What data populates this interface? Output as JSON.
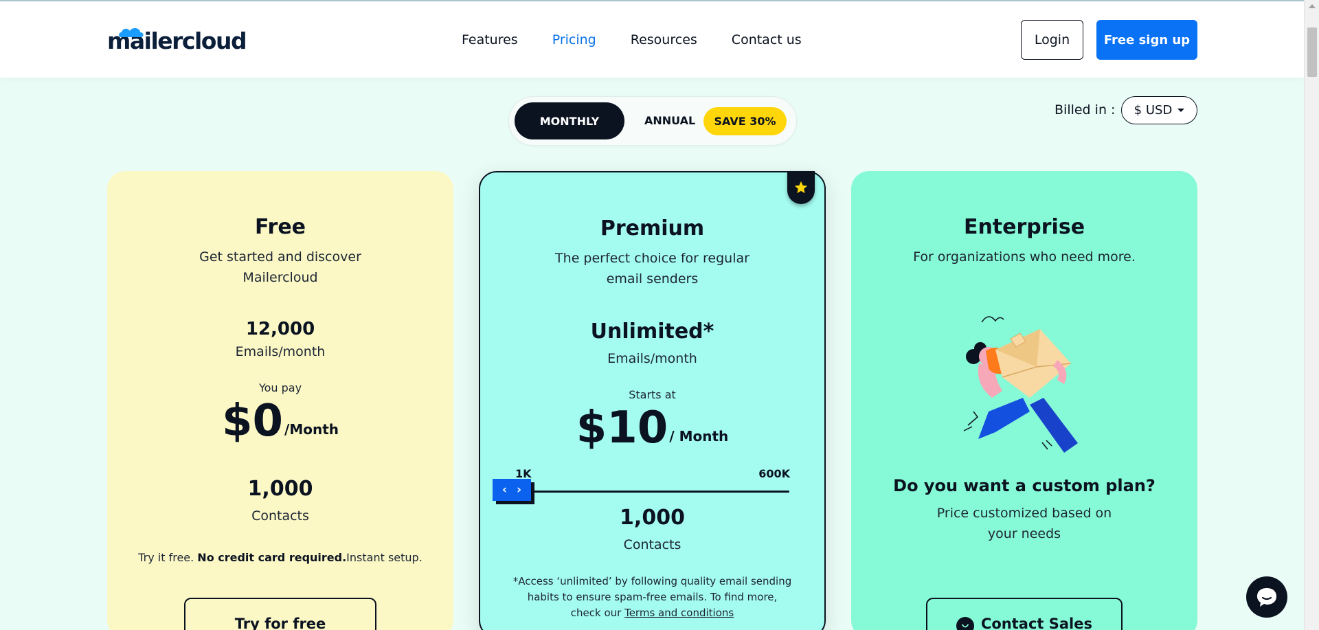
{
  "header": {
    "logo_text": "mailercloud",
    "nav": [
      {
        "label": "Features"
      },
      {
        "label": "Pricing"
      },
      {
        "label": "Resources"
      },
      {
        "label": "Contact us"
      }
    ],
    "login_label": "Login",
    "signup_label": "Free sign up"
  },
  "billing": {
    "monthly_label": "MONTHLY",
    "annual_label": "ANNUAL",
    "save_label": "SAVE 30%",
    "billed_in_label": "Billed in :",
    "currency_selected": "$ USD"
  },
  "plans": {
    "free": {
      "name": "Free",
      "description": "Get started and discover Mailercloud",
      "emails": "12,000",
      "emails_label": "Emails/month",
      "you_pay_label": "You pay",
      "price": "$0",
      "per": "/Month",
      "contacts": "1,000",
      "contacts_label": "Contacts",
      "note_prefix": "Try it free. ",
      "note_bold": "No credit card required.",
      "note_suffix": "Instant setup.",
      "cta_label": "Try for free"
    },
    "premium": {
      "name": "Premium",
      "description": "The perfect choice for regular email senders",
      "emails": "Unlimited*",
      "emails_label": "Emails/month",
      "starts_at_label": "Starts at",
      "price": "$10",
      "per": "/ Month",
      "slider_min": "1K",
      "slider_max": "600K",
      "slider_level": 0,
      "contacts": "1,000",
      "contacts_label": "Contacts",
      "note_text": "*Access ‘unlimited’ by following quality email sending habits to ensure spam-free emails. To find more, check our ",
      "terms_label": "Terms and conditions"
    },
    "enterprise": {
      "name": "Enterprise",
      "description": "For organizations who need more.",
      "question": "Do you want a custom plan?",
      "question_sub": "Price customized based on your needs",
      "cta_label": "Contact Sales"
    }
  },
  "colors": {
    "accent": "#0a72f5",
    "free_card": "#fbf8c6",
    "premium_card": "#a4fbf0",
    "enterprise_card": "#86fad6",
    "save_badge": "#ffd60a",
    "page_bg": "#eafcf6"
  },
  "icons": [
    "cloud-logo-icon",
    "chevron-down-icon",
    "star-icon",
    "chevron-left-icon",
    "chevron-right-icon",
    "phone-icon",
    "chat-icon"
  ]
}
